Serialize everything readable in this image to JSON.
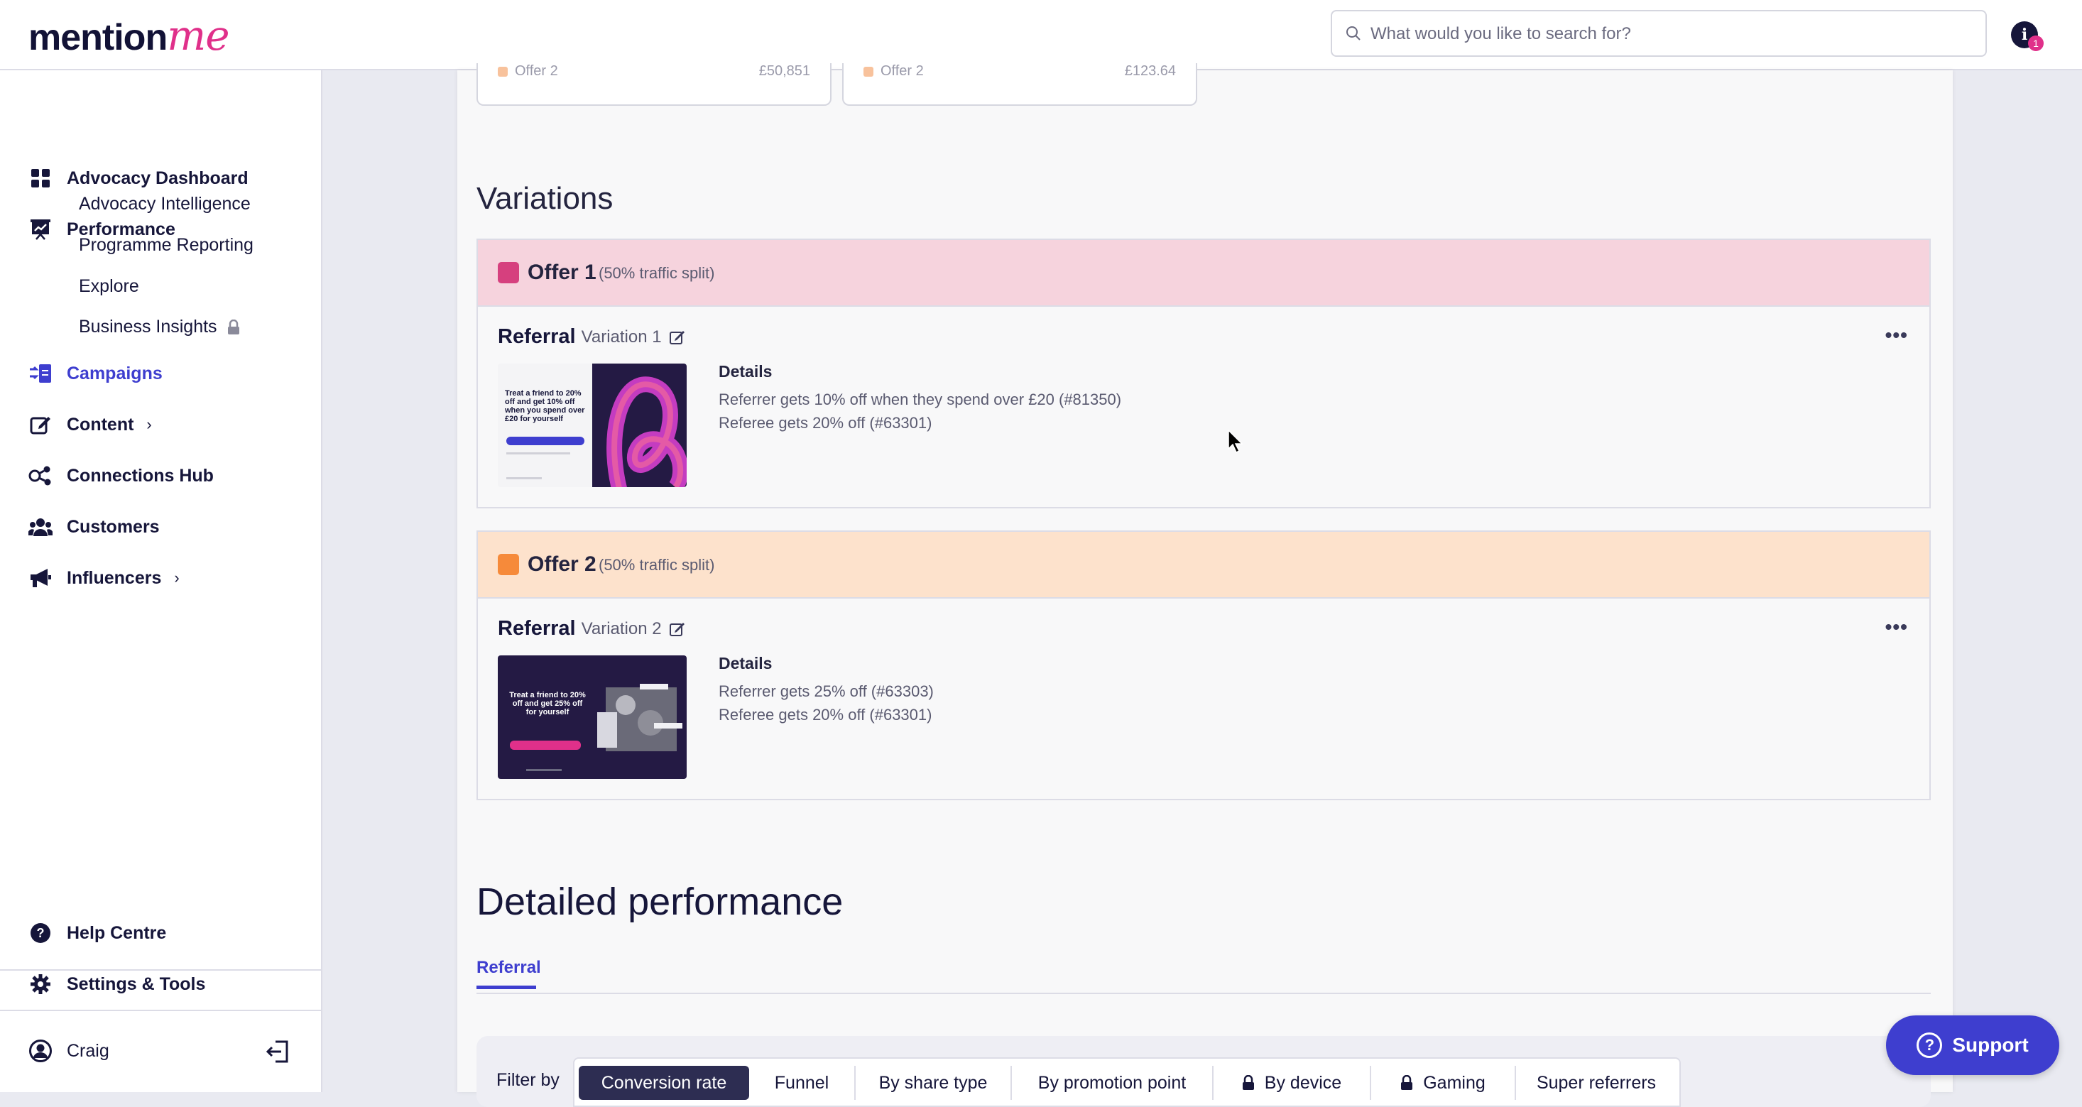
{
  "brand": {
    "logo_main": "mention",
    "logo_accent": "me"
  },
  "search": {
    "placeholder": "What would you like to search for?"
  },
  "notifications": {
    "icon_letter": "i",
    "count": "1"
  },
  "sidebar": {
    "items": [
      {
        "label": "Advocacy Dashboard",
        "icon": "grid-icon"
      },
      {
        "label": "Performance",
        "icon": "chart-presentation-icon"
      },
      {
        "label": "Campaigns",
        "icon": "campaigns-icon",
        "active": true
      },
      {
        "label": "Content",
        "icon": "edit-icon",
        "chevron": "›"
      },
      {
        "label": "Connections Hub",
        "icon": "connections-icon"
      },
      {
        "label": "Customers",
        "icon": "users-icon"
      },
      {
        "label": "Influencers",
        "icon": "megaphone-icon",
        "chevron": "›"
      }
    ],
    "performance_sub": [
      "Advocacy Intelligence",
      "Programme Reporting",
      "Explore",
      "Business Insights"
    ],
    "help": "Help Centre",
    "settings": "Settings & Tools",
    "user": "Craig"
  },
  "top_cards": [
    {
      "label": "Offer 2",
      "value": "£50,851"
    },
    {
      "label": "Offer 2",
      "value": "£123.64"
    }
  ],
  "variations": {
    "heading": "Variations",
    "offers": [
      {
        "title": "Offer 1",
        "split": "(50% traffic split)",
        "color": "#d6407e",
        "header_bg": "#f6d3dd",
        "referral_title": "Referral",
        "variation": "Variation 1",
        "details_label": "Details",
        "details": [
          "Referrer gets 10% off when they spend over £20 (#81350)",
          "Referee gets 20% off (#63301)"
        ],
        "thumb_text": "Treat a friend to 20% off and get 10% off when you spend over £20 for yourself"
      },
      {
        "title": "Offer 2",
        "split": "(50% traffic split)",
        "color": "#f68a3a",
        "header_bg": "#fde2cc",
        "referral_title": "Referral",
        "variation": "Variation 2",
        "details_label": "Details",
        "details": [
          "Referrer gets 25% off (#63303)",
          "Referee gets 20% off (#63301)"
        ],
        "thumb_text": "Treat a friend to 20% off and get 25% off for yourself"
      }
    ]
  },
  "detailed": {
    "heading": "Detailed performance",
    "tab": "Referral",
    "filter_label": "Filter by",
    "filters": [
      "Conversion rate",
      "Funnel",
      "By share type",
      "By promotion point",
      "By device",
      "Gaming",
      "Super referrers"
    ]
  },
  "support": {
    "label": "Support"
  }
}
